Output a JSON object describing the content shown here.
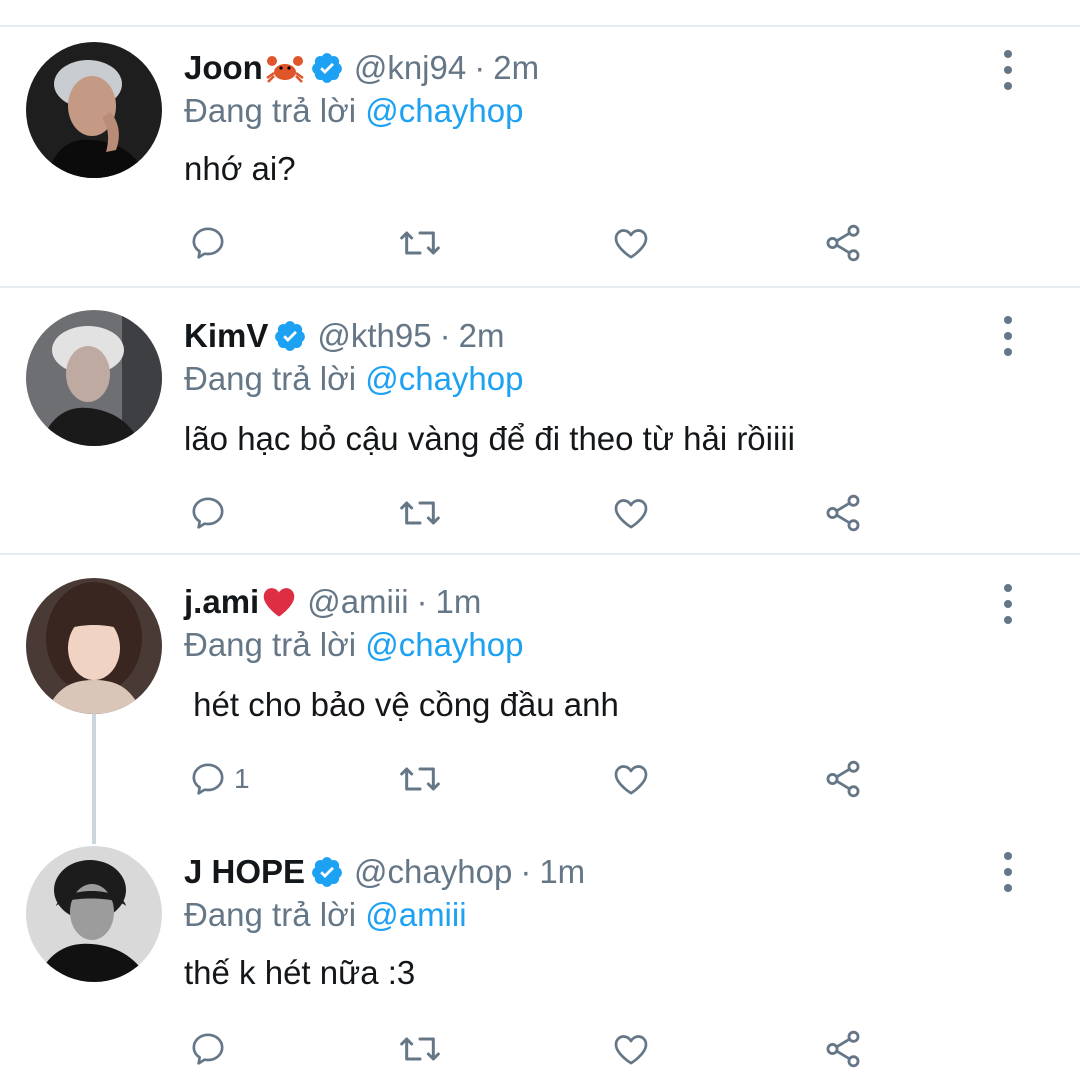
{
  "colors": {
    "accent": "#1da1f2",
    "secondary_text": "#657786",
    "divider": "#e6ecf0",
    "verified": "#1da1f2"
  },
  "tweets": [
    {
      "name": "Joon",
      "name_emoji": "crab-emoji",
      "verified": true,
      "handle": "@knj94",
      "separator": "·",
      "time": "2m",
      "reply_prefix": "Đang trả lời",
      "reply_to": "@chayhop",
      "text": "nhớ ai?",
      "reply_count": ""
    },
    {
      "name": "KimV",
      "name_emoji": "",
      "verified": true,
      "handle": "@kth95",
      "separator": "·",
      "time": "2m",
      "reply_prefix": "Đang trả lời",
      "reply_to": "@chayhop",
      "text": "lão hạc bỏ cậu vàng để đi theo từ hải rồiiii",
      "reply_count": ""
    },
    {
      "name": "j.ami",
      "name_emoji": "red-heart-emoji",
      "verified": false,
      "handle": "@amiii",
      "separator": "·",
      "time": "1m",
      "reply_prefix": "Đang trả lời",
      "reply_to": "@chayhop",
      "text": " hét cho bảo vệ cồng đầu anh",
      "reply_count": "1"
    },
    {
      "name": "J HOPE",
      "name_emoji": "",
      "verified": true,
      "handle": "@chayhop",
      "separator": "·",
      "time": "1m",
      "reply_prefix": "Đang trả lời",
      "reply_to": "@amiii",
      "text": "thế k hét nữa :3",
      "reply_count": ""
    }
  ],
  "icons": {
    "reply": "reply-icon",
    "retweet": "retweet-icon",
    "like": "like-icon",
    "share": "share-icon",
    "more": "more-options-icon",
    "verified": "verified-badge-icon"
  }
}
